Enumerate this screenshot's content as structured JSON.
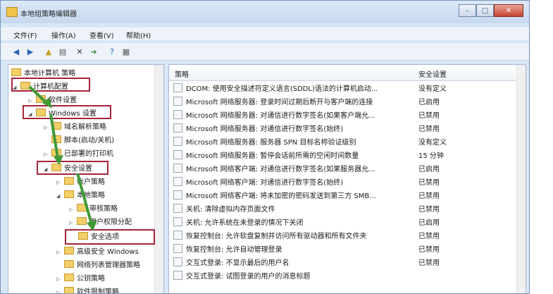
{
  "title": "本地组策略编辑器",
  "menu": [
    "文件(F)",
    "操作(A)",
    "查看(V)",
    "帮助(H)"
  ],
  "tree": [
    {
      "label": "本地计算机 策略",
      "exp": ""
    },
    {
      "label": "计算机配置",
      "exp": "◢"
    },
    {
      "label": "软件设置",
      "exp": "▷"
    },
    {
      "label": "Windows 设置",
      "exp": "◢"
    },
    {
      "label": "域名解析策略",
      "exp": "▷"
    },
    {
      "label": "脚本(启动/关机)",
      "exp": ""
    },
    {
      "label": "已部署的打印机",
      "exp": "▷"
    },
    {
      "label": "安全设置",
      "exp": "◢"
    },
    {
      "label": "帐户策略",
      "exp": "▷"
    },
    {
      "label": "本地策略",
      "exp": "◢"
    },
    {
      "label": "审核策略",
      "exp": "▷"
    },
    {
      "label": "用户权限分配",
      "exp": "▷"
    },
    {
      "label": "安全选项",
      "exp": ""
    },
    {
      "label": "高级安全 Windows",
      "exp": "▷"
    },
    {
      "label": "网络列表管理器策略",
      "exp": ""
    },
    {
      "label": "公钥策略",
      "exp": "▷"
    },
    {
      "label": "软件限制策略",
      "exp": "▷"
    }
  ],
  "columns": {
    "policy": "策略",
    "setting": "安全设置"
  },
  "rows": [
    {
      "policy": "DCOM: 使用安全描述符定义语言(SDDL)语法的计算机启动...",
      "setting": "没有定义"
    },
    {
      "policy": "Microsoft 网络服务器: 登录时间过期后断开与客户端的连接",
      "setting": "已启用"
    },
    {
      "policy": "Microsoft 网络服务器: 对通信进行数字签名(如果客户端允...",
      "setting": "已禁用"
    },
    {
      "policy": "Microsoft 网络服务器: 对通信进行数字签名(始终)",
      "setting": "已禁用"
    },
    {
      "policy": "Microsoft 网络服务器: 服务器 SPN 目标名称验证级别",
      "setting": "没有定义"
    },
    {
      "policy": "Microsoft 网络服务器: 暂停会话前所需的空闲时间数量",
      "setting": "15 分钟"
    },
    {
      "policy": "Microsoft 网络客户端: 对通信进行数字签名(如果服务器允...",
      "setting": "已启用"
    },
    {
      "policy": "Microsoft 网络客户端: 对通信进行数字签名(始终)",
      "setting": "已禁用"
    },
    {
      "policy": "Microsoft 网络客户端: 将未加密的密码发送到第三方 SMB...",
      "setting": "已禁用"
    },
    {
      "policy": "关机: 清除虚拟内存页面文件",
      "setting": "已禁用"
    },
    {
      "policy": "关机: 允许系统在未登录的情况下关闭",
      "setting": "已启用"
    },
    {
      "policy": "恢复控制台: 允许软盘复制并访问所有驱动器和所有文件夹",
      "setting": "已禁用"
    },
    {
      "policy": "恢复控制台: 允许自动管理登录",
      "setting": "已禁用"
    },
    {
      "policy": "交互式登录: 不显示最后的用户名",
      "setting": "已禁用"
    },
    {
      "policy": "交互式登录: 试图登录的用户的消息标题",
      "setting": ""
    }
  ]
}
